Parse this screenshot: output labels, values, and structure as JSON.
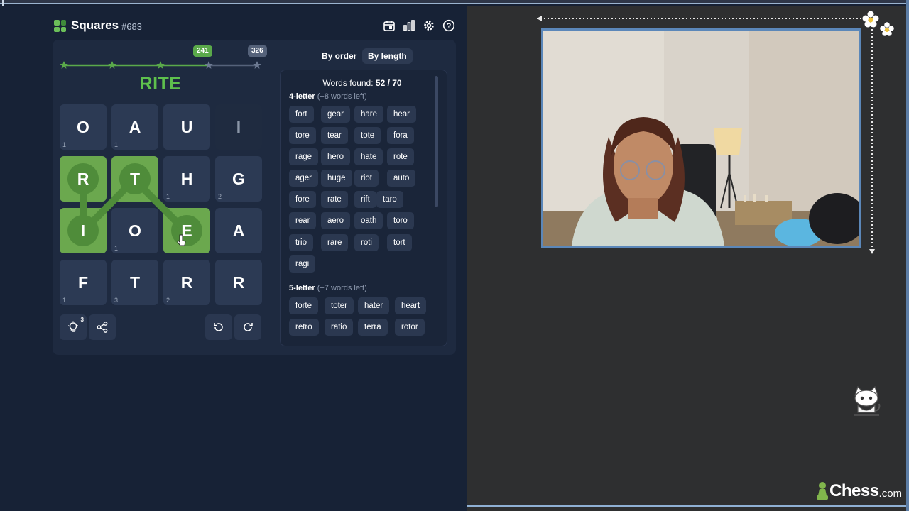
{
  "header": {
    "title": "Squares",
    "puzzle_number": "#683",
    "icons": [
      "calendar-icon",
      "stats-icon",
      "settings-icon",
      "help-icon"
    ]
  },
  "progress": {
    "milestones": [
      "241",
      "326"
    ],
    "stars_total": 5,
    "stars_reached": 3
  },
  "current_word": "RITE",
  "grid": {
    "rows": [
      [
        {
          "l": "O",
          "c": "1"
        },
        {
          "l": "A",
          "c": "1"
        },
        {
          "l": "U",
          "c": ""
        },
        {
          "l": "I",
          "c": ""
        }
      ],
      [
        {
          "l": "R",
          "c": ""
        },
        {
          "l": "T",
          "c": ""
        },
        {
          "l": "H",
          "c": "1"
        },
        {
          "l": "G",
          "c": "2"
        }
      ],
      [
        {
          "l": "I",
          "c": ""
        },
        {
          "l": "O",
          "c": "1"
        },
        {
          "l": "E",
          "c": ""
        },
        {
          "l": "A",
          "c": ""
        }
      ],
      [
        {
          "l": "F",
          "c": "1"
        },
        {
          "l": "T",
          "c": "3"
        },
        {
          "l": "R",
          "c": "2"
        },
        {
          "l": "R",
          "c": ""
        }
      ]
    ]
  },
  "controls": {
    "hint_count": "3"
  },
  "sort_tabs": [
    "By order",
    "By length"
  ],
  "words_found": {
    "label": "Words found: ",
    "value": "52 / 70"
  },
  "groups": [
    {
      "title": "4-letter",
      "left": "(+8 words left)",
      "words": [
        "fort",
        "gear",
        "hare",
        "hear",
        "tore",
        "tear",
        "tote",
        "fora",
        "rage",
        "hero",
        "hate",
        "rote",
        "ager",
        "huge",
        "riot",
        "auto",
        "fore",
        "rate",
        "rift",
        "taro",
        "rear",
        "aero",
        "oath",
        "toro",
        "trio",
        "rare",
        "roti",
        "tort",
        "ragi"
      ]
    },
    {
      "title": "5-letter",
      "left": "(+7 words left)",
      "words": [
        "forte",
        "toter",
        "hater",
        "heart",
        "retro",
        "ratio",
        "terra",
        "rotor"
      ]
    }
  ],
  "branding": {
    "chess_word": "Chess",
    "chess_suffix": ".com"
  },
  "colors": {
    "accent_green": "#5ec04d",
    "tile": "#2c3a54",
    "tile_selected": "#6ba84e",
    "cam_border": "#5b87b9"
  }
}
